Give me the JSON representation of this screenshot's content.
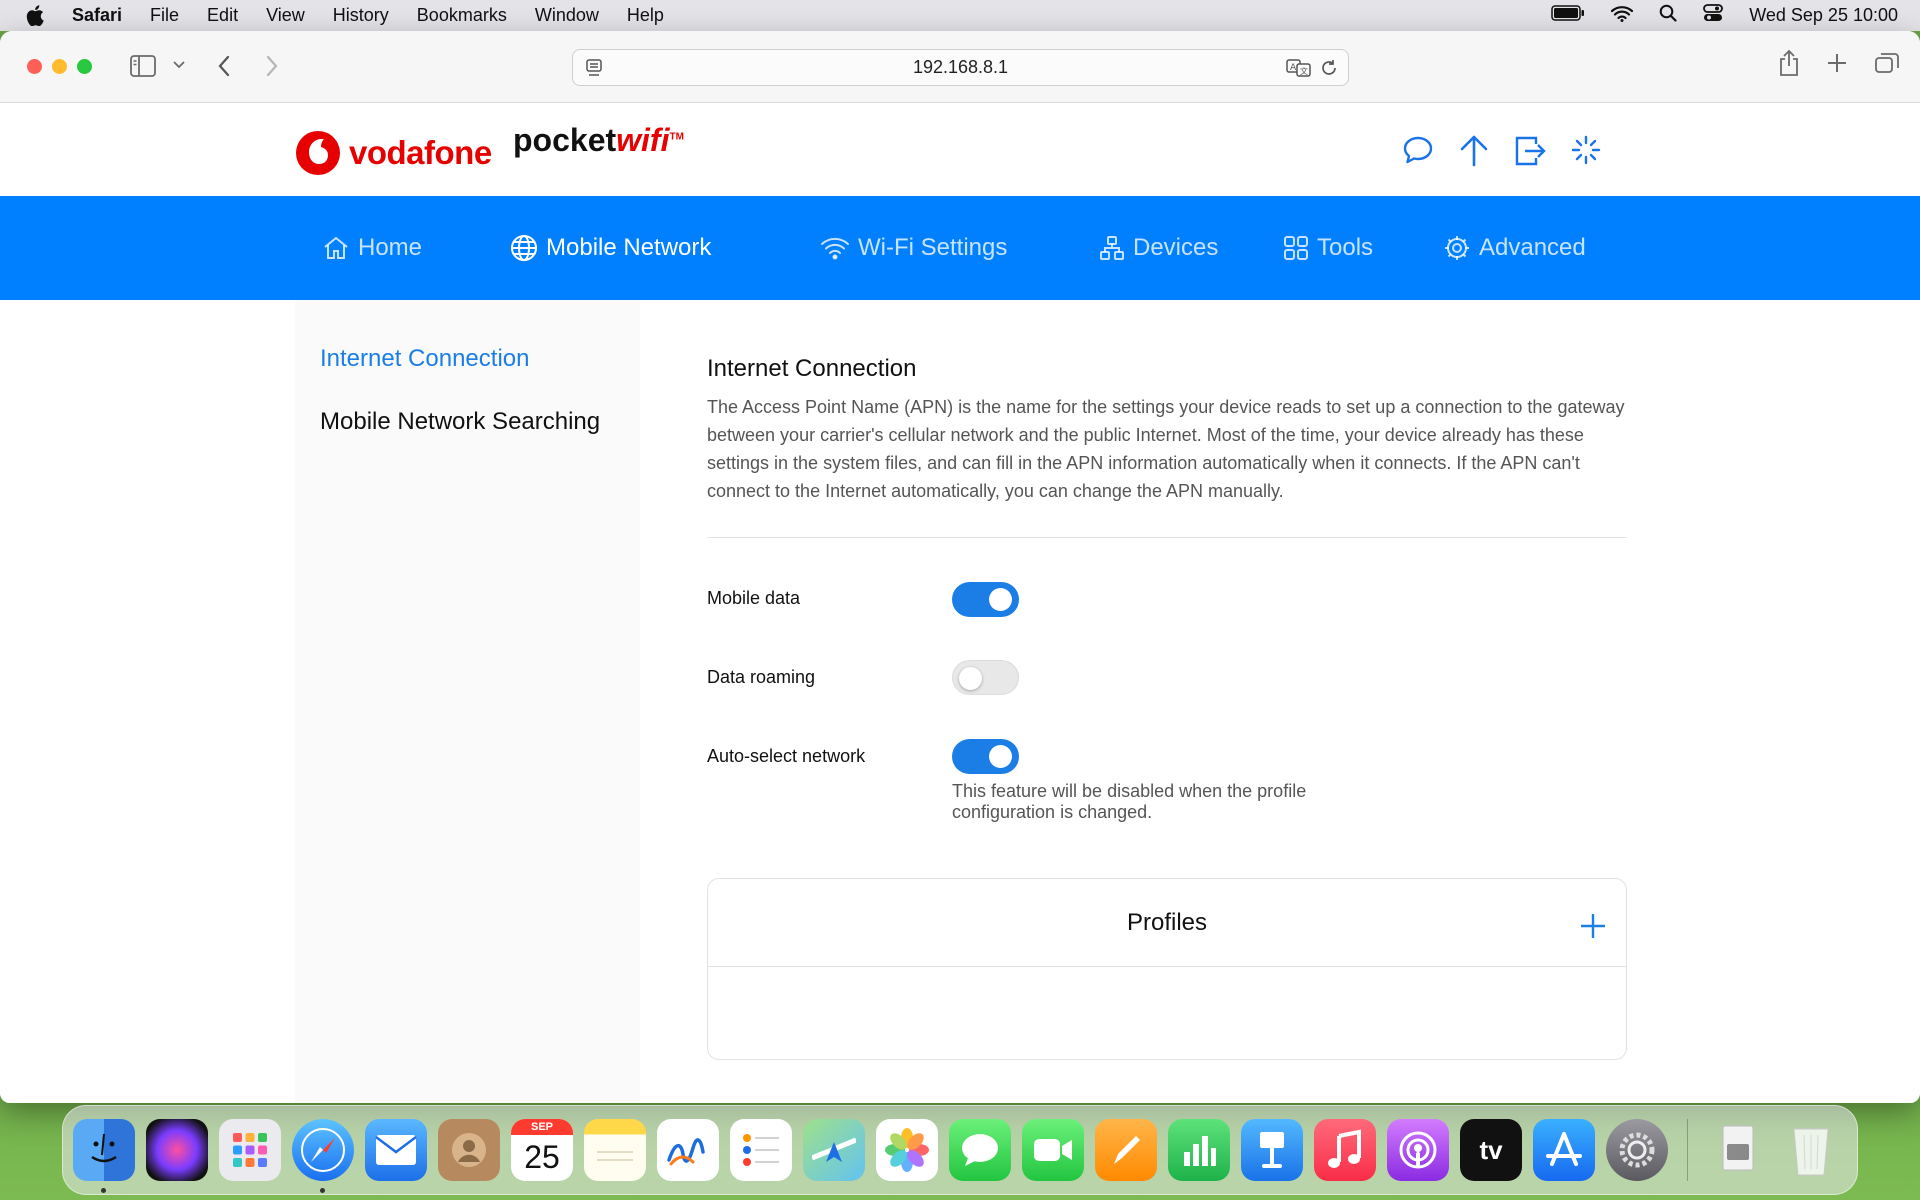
{
  "menubar": {
    "app": "Safari",
    "items": [
      "File",
      "Edit",
      "View",
      "History",
      "Bookmarks",
      "Window",
      "Help"
    ],
    "clock": "Wed Sep 25  10:00"
  },
  "browser": {
    "url": "192.168.8.1"
  },
  "brand": {
    "vodafone": "vodafone",
    "pocket": "pocket",
    "wifi": "wifi",
    "tm": "TM"
  },
  "nav": {
    "home": "Home",
    "mobile_network": "Mobile Network",
    "wifi_settings": "Wi-Fi Settings",
    "devices": "Devices",
    "tools": "Tools",
    "advanced": "Advanced"
  },
  "sidebar": {
    "items": [
      {
        "label": "Internet Connection",
        "active": true
      },
      {
        "label": "Mobile Network Searching",
        "active": false
      }
    ]
  },
  "main": {
    "title": "Internet Connection",
    "description": "The Access Point Name (APN) is the name for the settings your device reads to set up a connection to the gateway between your carrier's cellular network and the public Internet. Most of the time, your device already has these settings in the system files, and can fill in the APN information automatically when it connects. If the APN can't connect to the Internet automatically, you can change the APN manually.",
    "settings": [
      {
        "label": "Mobile data",
        "on": true
      },
      {
        "label": "Data roaming",
        "on": false
      },
      {
        "label": "Auto-select network",
        "on": true
      }
    ],
    "auto_select_hint": "This feature will be disabled when the profile configuration is changed.",
    "profiles_title": "Profiles"
  },
  "dock": {
    "calendar_month": "SEP",
    "calendar_day": "25",
    "tv_label": "tv",
    "apps": [
      "Finder",
      "Siri",
      "Launchpad",
      "Safari",
      "Mail",
      "Contacts",
      "Calendar",
      "Notes",
      "Freeform",
      "Reminders",
      "Maps",
      "Photos",
      "Messages",
      "FaceTime",
      "Pages",
      "Numbers",
      "Keynote",
      "Music",
      "Podcasts",
      "TV",
      "App Store",
      "System Settings",
      "Downloads",
      "Trash"
    ]
  },
  "colors": {
    "nav_blue": "#0080ff",
    "accent_blue": "#1a7ee6",
    "vodafone_red": "#e60000"
  }
}
